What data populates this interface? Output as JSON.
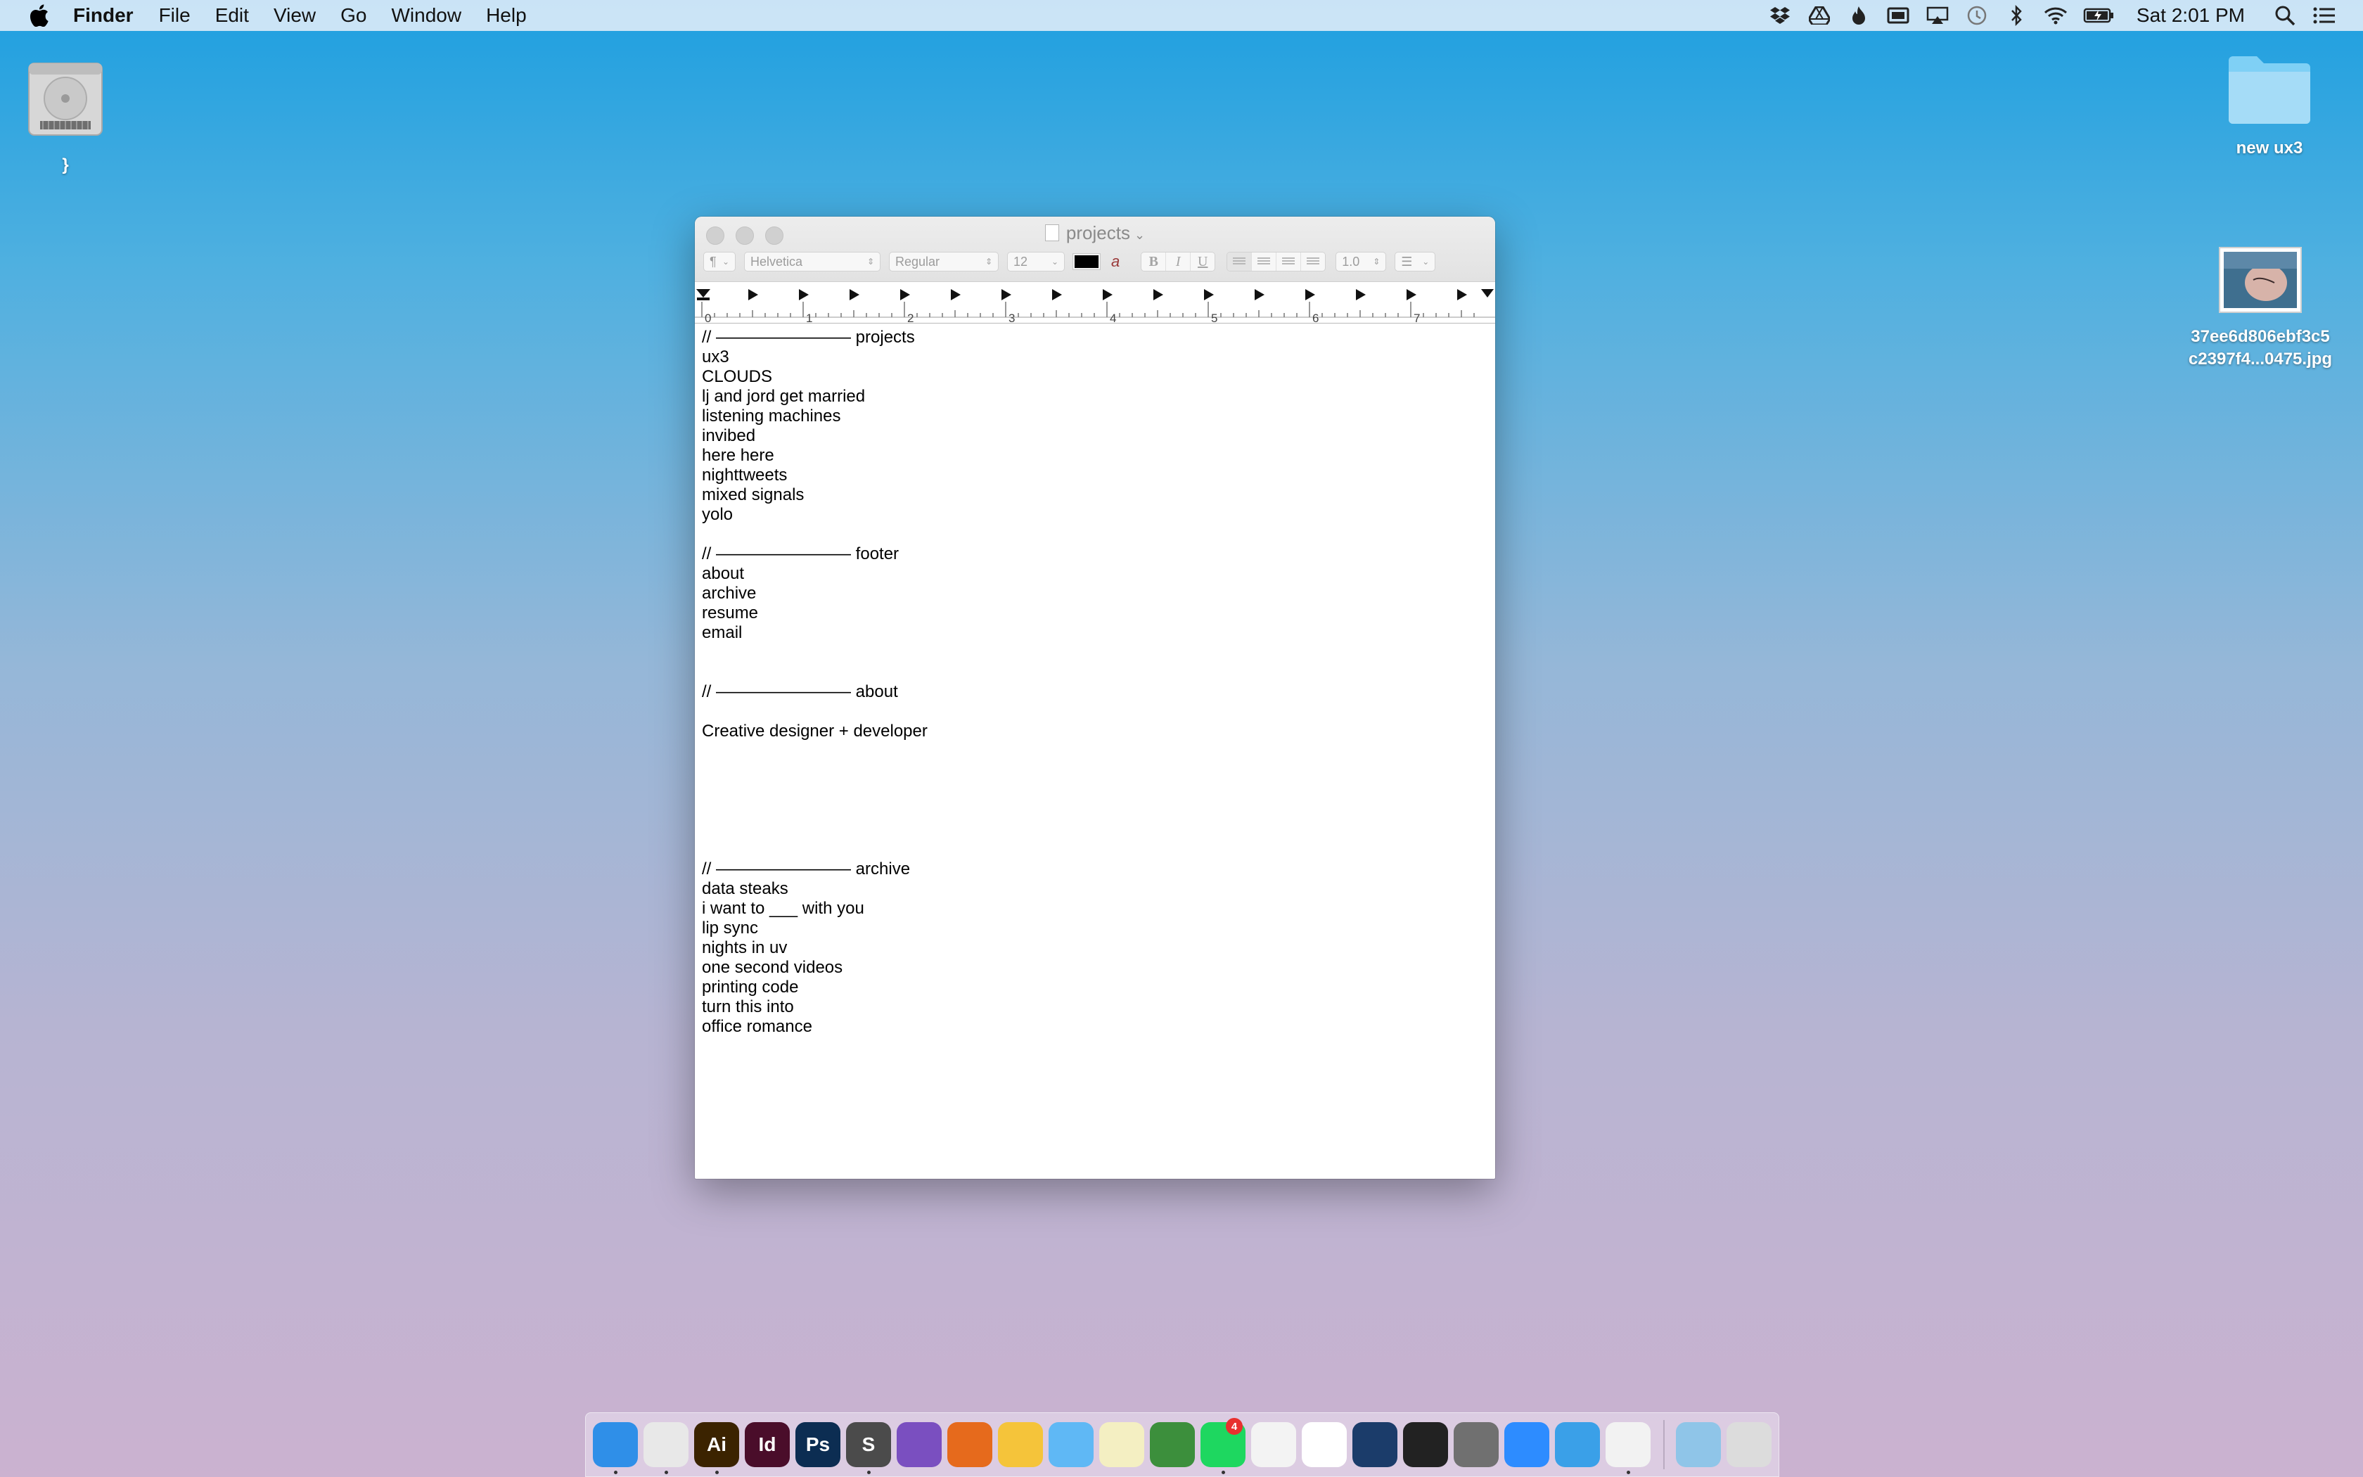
{
  "menubar": {
    "app_name": "Finder",
    "menus": [
      "File",
      "Edit",
      "View",
      "Go",
      "Window",
      "Help"
    ],
    "status_icons": [
      "dropbox-icon",
      "google-drive-icon",
      "flame-icon",
      "mirror-icon",
      "airplay-icon",
      "time-machine-icon",
      "bluetooth-icon",
      "wifi-icon",
      "battery-icon"
    ],
    "clock": "Sat 2:01 PM"
  },
  "desktop": {
    "drive_label": "}",
    "folder_label": "new ux3",
    "image_label": "37ee6d806ebf3c5\nc2397f4...0475.jpg"
  },
  "window": {
    "title": "projects",
    "format_bar": {
      "paragraph_style": "¶",
      "font_family": "Helvetica",
      "font_style": "Regular",
      "font_size": "12",
      "bold": "B",
      "italic": "I",
      "underline": "U",
      "line_spacing": "1.0",
      "text_color": "#000000"
    },
    "ruler_labels": [
      "0",
      "1",
      "2",
      "3",
      "4",
      "5",
      "6",
      "7"
    ],
    "document_lines": [
      "// ———————— projects",
      "ux3",
      "CLOUDS",
      "lj and jord get married",
      "listening machines",
      "invibed",
      "here here",
      "nighttweets",
      "mixed signals",
      "yolo",
      "",
      "// ———————— footer",
      "about",
      "archive",
      "resume",
      "email",
      "",
      "",
      "// ———————— about",
      "",
      "Creative designer + developer",
      "",
      "",
      "",
      "",
      "",
      "",
      "// ———————— archive",
      "data steaks",
      "i want to ___ with you",
      "lip sync",
      "nights in uv",
      "one second videos",
      "printing code",
      "turn this into",
      "office romance"
    ]
  },
  "dock": {
    "apps": [
      {
        "name": "finder",
        "label": "",
        "color": "#2f8fe8",
        "running": true
      },
      {
        "name": "chrome",
        "label": "",
        "color": "#e8e8e8",
        "running": true
      },
      {
        "name": "illustrator",
        "label": "Ai",
        "color": "#3b2300",
        "running": true
      },
      {
        "name": "indesign",
        "label": "Id",
        "color": "#4a0d2a",
        "running": false
      },
      {
        "name": "photoshop",
        "label": "Ps",
        "color": "#0c2d52",
        "running": false
      },
      {
        "name": "sublime-text",
        "label": "S",
        "color": "#4b4b4b",
        "running": true
      },
      {
        "name": "github-desktop",
        "label": "",
        "color": "#7a4fc0",
        "running": false
      },
      {
        "name": "firefox",
        "label": "",
        "color": "#e66a1c",
        "running": false
      },
      {
        "name": "cyberduck",
        "label": "",
        "color": "#f5c43a",
        "running": false
      },
      {
        "name": "messages",
        "label": "",
        "color": "#5fb8f5",
        "running": false
      },
      {
        "name": "notes",
        "label": "",
        "color": "#f4efc2",
        "running": false
      },
      {
        "name": "evernote",
        "label": "",
        "color": "#3c8f3c",
        "running": false
      },
      {
        "name": "spotify",
        "label": "",
        "color": "#1ed760",
        "running": true,
        "badge": "4"
      },
      {
        "name": "itunes",
        "label": "",
        "color": "#f3f3f3",
        "running": false
      },
      {
        "name": "numbers",
        "label": "",
        "color": "#ffffff",
        "running": false
      },
      {
        "name": "steam",
        "label": "",
        "color": "#1b3c6a",
        "running": false
      },
      {
        "name": "obs",
        "label": "",
        "color": "#222222",
        "running": false
      },
      {
        "name": "system-preferences",
        "label": "",
        "color": "#707070",
        "running": false
      },
      {
        "name": "zoom",
        "label": "",
        "color": "#2d8cff",
        "running": false
      },
      {
        "name": "app-store-utility",
        "label": "",
        "color": "#3aa0e8",
        "running": false
      },
      {
        "name": "textedit",
        "label": "",
        "color": "#f2f2f2",
        "running": true
      }
    ],
    "folders": [
      {
        "name": "downloads",
        "color": "#8fc5e8"
      },
      {
        "name": "trash",
        "color": "#dcdcdc"
      }
    ]
  }
}
